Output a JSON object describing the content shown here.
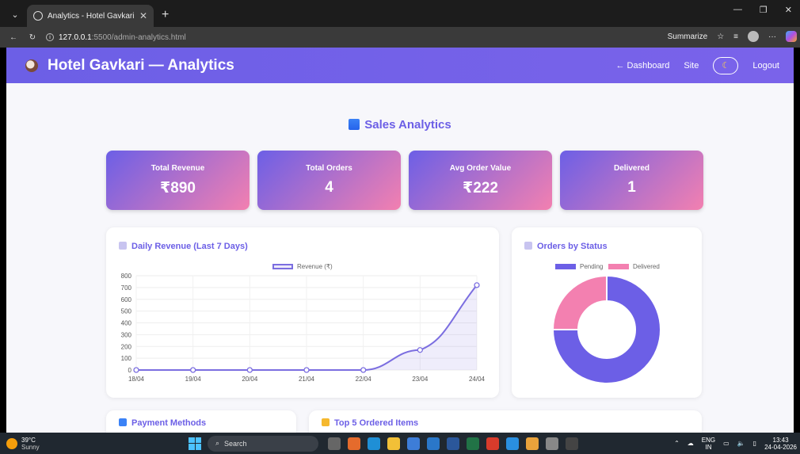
{
  "browser": {
    "tab_title": "Analytics - Hotel Gavkari Admin",
    "url_host": "127.0.0.1",
    "url_path": ":5500/admin-analytics.html",
    "summarize_label": "Summarize"
  },
  "header": {
    "brand": "Hotel Gavkari — Analytics",
    "nav_dashboard": "← Dashboard",
    "nav_site": "Site",
    "nav_logout": "Logout"
  },
  "page_title": "Sales Analytics",
  "stats": [
    {
      "label": "Total Revenue",
      "value": "₹890"
    },
    {
      "label": "Total Orders",
      "value": "4"
    },
    {
      "label": "Avg Order Value",
      "value": "₹222"
    },
    {
      "label": "Delivered",
      "value": "1"
    }
  ],
  "cards": {
    "daily_revenue": "Daily Revenue (Last 7 Days)",
    "orders_by_status": "Orders by Status",
    "payment_methods": "Payment Methods",
    "top_items": "Top 5 Ordered Items"
  },
  "colors": {
    "accent": "#6c5fe6",
    "pink": "#f380b0"
  },
  "chart_data": [
    {
      "type": "line",
      "title": "Daily Revenue (Last 7 Days)",
      "categories": [
        "18/04",
        "19/04",
        "20/04",
        "21/04",
        "22/04",
        "23/04",
        "24/04"
      ],
      "series": [
        {
          "name": "Revenue (₹)",
          "values": [
            0,
            0,
            0,
            0,
            0,
            170,
            720
          ]
        }
      ],
      "ylim": [
        0,
        800
      ],
      "yticks": [
        0,
        100,
        200,
        300,
        400,
        500,
        600,
        700,
        800
      ],
      "grid": true,
      "legend": "top"
    },
    {
      "type": "pie",
      "title": "Orders by Status",
      "categories": [
        "Pending",
        "Delivered"
      ],
      "values": [
        3,
        1
      ],
      "legend": "top"
    }
  ],
  "taskbar": {
    "temp": "39°C",
    "weather": "Sunny",
    "search": "Search",
    "lang1": "ENG",
    "lang2": "IN",
    "time": "13:43",
    "date": "24-04-2026"
  }
}
